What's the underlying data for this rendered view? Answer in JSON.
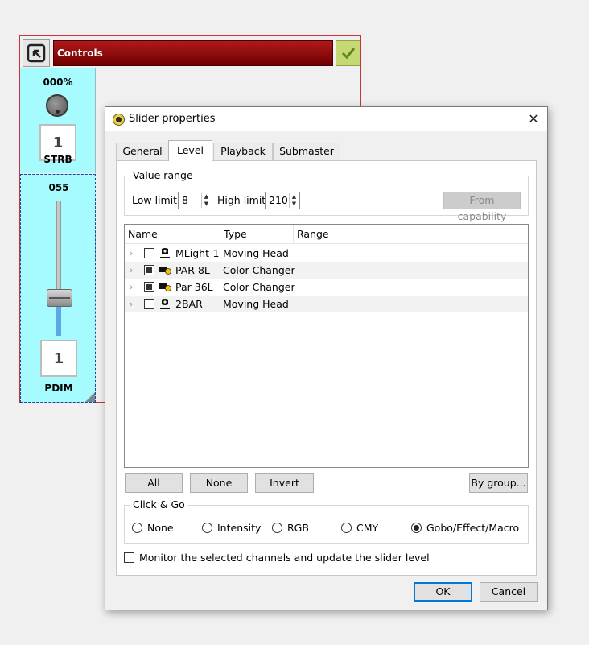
{
  "frame": {
    "title": "Controls",
    "strb": {
      "value": "000%",
      "number": "1",
      "name": "STRB"
    },
    "pdim": {
      "value": "055",
      "number": "1",
      "name": "PDIM",
      "level_percent": 26
    }
  },
  "dialog": {
    "title": "Slider properties",
    "close_glyph": "✕",
    "tabs": [
      "General",
      "Level",
      "Playback",
      "Submaster"
    ],
    "active_tab": "Level",
    "value_range": {
      "title": "Value range",
      "low_label": "Low limit",
      "low_value": "8",
      "high_label": "High limit",
      "high_value": "210",
      "from_capability": "From capability"
    },
    "tree": {
      "columns": [
        "Name",
        "Type",
        "Range"
      ],
      "rows": [
        {
          "name": "MLight-1",
          "type": "Moving Head",
          "checked": false,
          "icon": "moving-head-icon"
        },
        {
          "name": "PAR 8L",
          "type": "Color Changer",
          "checked": true,
          "icon": "color-changer-icon"
        },
        {
          "name": "Par 36L",
          "type": "Color Changer",
          "checked": true,
          "icon": "color-changer-icon"
        },
        {
          "name": "2BAR",
          "type": "Moving Head",
          "checked": false,
          "icon": "moving-head-icon"
        }
      ]
    },
    "buttons": {
      "all": "All",
      "none": "None",
      "invert": "Invert",
      "by_group": "By group..."
    },
    "click_go": {
      "title": "Click & Go",
      "options": [
        "None",
        "Intensity",
        "RGB",
        "CMY",
        "Gobo/Effect/Macro"
      ],
      "selected": "Gobo/Effect/Macro"
    },
    "monitor_label": "Monitor the selected channels and update the slider level",
    "ok": "OK",
    "cancel": "Cancel"
  }
}
